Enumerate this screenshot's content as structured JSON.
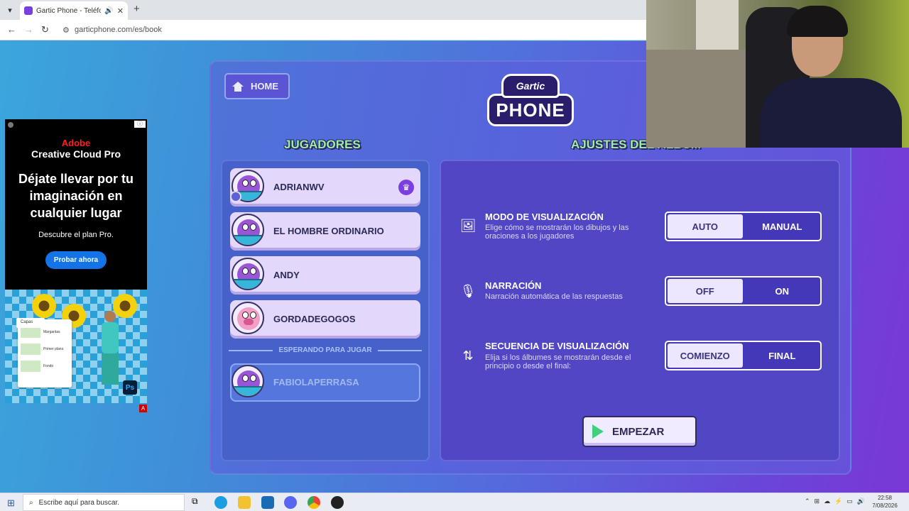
{
  "browser": {
    "tab_title": "Gartic Phone - Teléfono De",
    "url": "garticphone.com/es/book"
  },
  "ad": {
    "brand": "Adobe",
    "product": "Creative Cloud Pro",
    "headline": "Déjate llevar por tu imaginación en cualquier lugar",
    "subtext": "Descubre el plan Pro.",
    "cta": "Probar ahora",
    "panel_title": "Capas",
    "layers": [
      "Margaritas",
      "Primer plano",
      "Fondo"
    ],
    "ps_label": "Ps",
    "adchoice_label": "A"
  },
  "game": {
    "home_label": "HOME",
    "logo_top": "Gartic",
    "logo_bottom": "PHONE",
    "players_title": "JUGADORES",
    "settings_title": "AJUSTES DEL ÁLBUM",
    "players": [
      {
        "name": "ADRIANWV",
        "host": true
      },
      {
        "name": "EL HOMBRE ORDINARIO"
      },
      {
        "name": "ANDY"
      },
      {
        "name": "GORDADEGOGOS"
      }
    ],
    "waiting_label": "ESPERANDO PARA JUGAR",
    "waiting_players": [
      {
        "name": "FABIOLAPERRASA"
      }
    ],
    "settings": [
      {
        "title": "MODO DE VISUALIZACIÓN",
        "desc": "Elige cómo se mostrarán los dibujos y las oraciones a los jugadores",
        "options": [
          "AUTO",
          "MANUAL"
        ],
        "selected": "AUTO",
        "icon": "image-icon"
      },
      {
        "title": "NARRACIÓN",
        "desc": "Narración automática de las respuestas",
        "options": [
          "OFF",
          "ON"
        ],
        "selected": "OFF",
        "icon": "microphone-icon"
      },
      {
        "title": "SECUENCIA DE VISUALIZACIÓN",
        "desc": "Elija si los álbumes se mostrarán desde el principio o desde el final:",
        "options": [
          "COMIENZO",
          "FINAL"
        ],
        "selected": "COMIENZO",
        "icon": "sort-arrows-icon"
      }
    ],
    "start_label": "EMPEZAR"
  },
  "taskbar": {
    "search_placeholder": "Escribe aquí para buscar.",
    "time": "22:58",
    "date": "7/08/2026"
  }
}
